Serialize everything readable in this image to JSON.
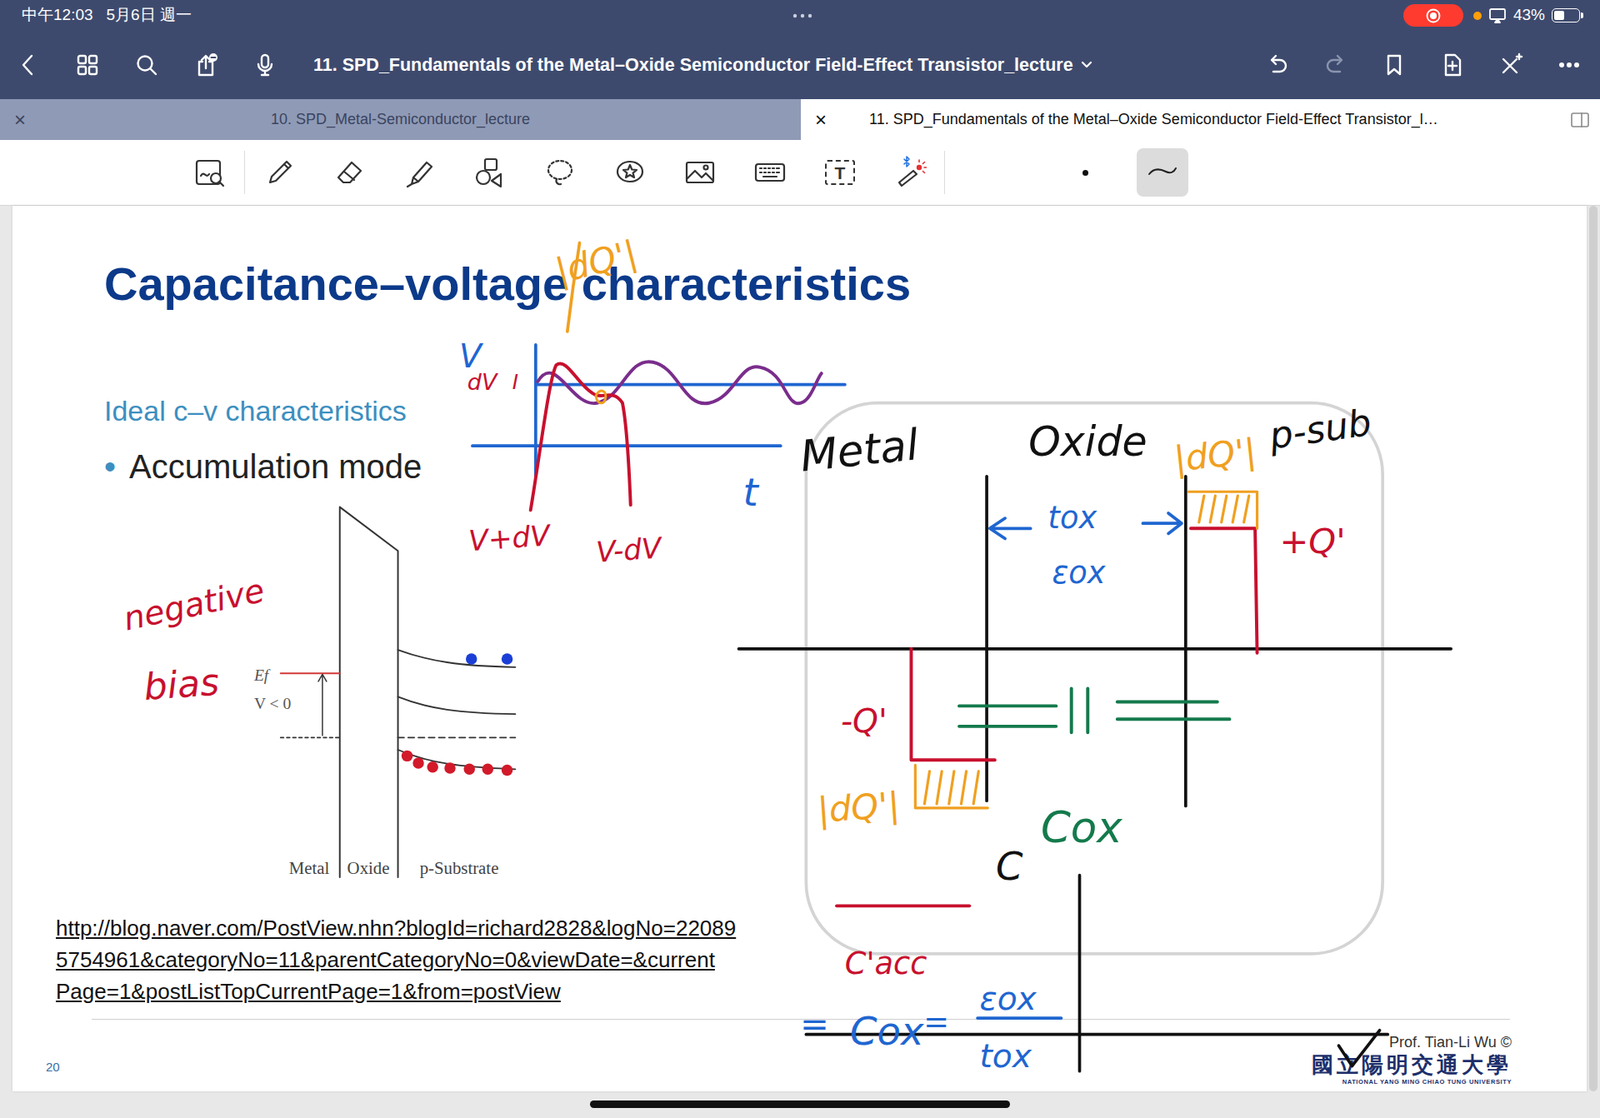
{
  "status_bar": {
    "time": "中午12:03",
    "date": "5月6日 週一",
    "recording": true,
    "battery": "43%",
    "battery_level": 0.43
  },
  "toolbar": {
    "left": [
      {
        "kind": "back"
      },
      {
        "kind": "grid"
      },
      {
        "kind": "search"
      },
      {
        "kind": "share"
      },
      {
        "kind": "mic"
      }
    ],
    "title": "11. SPD_Fundamentals of the Metal–Oxide Semiconductor Field-Effect Transistor_lecture",
    "right": [
      {
        "kind": "undo",
        "disabled": false
      },
      {
        "kind": "redo",
        "disabled": true
      },
      {
        "kind": "bookmark",
        "disabled": false
      },
      {
        "kind": "add-page",
        "disabled": false
      },
      {
        "kind": "close-tools",
        "disabled": false
      },
      {
        "kind": "more",
        "disabled": false
      }
    ]
  },
  "tabs": [
    {
      "label": "10. SPD_Metal-Semiconductor_lecture",
      "close": "×",
      "selected": false
    },
    {
      "label": "11. SPD_Fundamentals of the Metal–Oxide Semiconductor Field-Effect Transistor_l…",
      "close": "×",
      "selected": true
    }
  ],
  "tools": [
    {
      "kind": "zoom-write",
      "selected": false
    },
    {
      "kind": "pen",
      "selected": false
    },
    {
      "kind": "eraser",
      "selected": false
    },
    {
      "kind": "highlighter",
      "selected": false
    },
    {
      "kind": "shapes",
      "selected": false
    },
    {
      "kind": "lasso",
      "selected": false
    },
    {
      "kind": "sticker",
      "selected": false
    },
    {
      "kind": "image",
      "selected": false
    },
    {
      "kind": "keyboard",
      "selected": false
    },
    {
      "kind": "text",
      "label": "T",
      "selected": false
    },
    {
      "kind": "laser",
      "selected": false
    }
  ],
  "pen_options": [
    {
      "kind": "dot",
      "selected": false
    },
    {
      "kind": "stroke",
      "selected": true
    }
  ],
  "slide": {
    "title": "Capacitance–voltage characteristics",
    "subtitle": "Ideal c–v characteristics",
    "bullet": "•",
    "bullet_text": "Accumulation mode",
    "url_lines": [
      "http://blog.naver.com/PostView.nhn?blogId=richard2828&logNo=22089",
      "5754961&categoryNo=11&parentCategoryNo=0&viewDate=&current",
      "Page=1&postListTopCurrentPage=1&from=postView"
    ],
    "page_number": "20",
    "credit": "Prof. Tian-Li Wu ©",
    "logo_zh": "國立陽明交通大學",
    "logo_en": "NATIONAL YANG MING CHIAO TUNG UNIVERSITY"
  },
  "figure": {
    "ef": "Ef",
    "bias": "V < 0",
    "layers": [
      "Metal",
      "Oxide",
      "p-Substrate"
    ]
  },
  "annotations": [
    {
      "text": "|dQ'|",
      "color": "#f0a020"
    },
    {
      "text": "V",
      "color": "#1f66d1"
    },
    {
      "text": "dV",
      "color": "#c8102e"
    },
    {
      "text": "I",
      "color": "#c8102e"
    },
    {
      "text": "t",
      "color": "#1f66d1"
    },
    {
      "text": "V+dV",
      "color": "#c8102e"
    },
    {
      "text": "V-dV",
      "color": "#c8102e"
    },
    {
      "text": "negative",
      "color": "#c8102e"
    },
    {
      "text": "bias",
      "color": "#c8102e"
    },
    {
      "text": "Metal",
      "color": "#111111"
    },
    {
      "text": "Oxide",
      "color": "#111111"
    },
    {
      "text": "|dQ'|",
      "color": "#f0a020"
    },
    {
      "text": "p-sub",
      "color": "#111111"
    },
    {
      "text": "tox",
      "color": "#1f66d1"
    },
    {
      "text": "εox",
      "color": "#1f66d1"
    },
    {
      "text": "+Q'",
      "color": "#c8102e"
    },
    {
      "text": "-Q'",
      "color": "#c8102e"
    },
    {
      "text": "|dQ'|",
      "color": "#f0a020"
    },
    {
      "text": "Cox",
      "color": "#147a4c"
    },
    {
      "text": "C",
      "color": "#111111"
    },
    {
      "text": "C'acc",
      "color": "#c8102e"
    },
    {
      "text": "=",
      "color": "#1f66d1"
    },
    {
      "text": "Cox",
      "color": "#1f66d1"
    },
    {
      "text": "=",
      "color": "#1f66d1"
    },
    {
      "text": "εox",
      "color": "#1f66d1"
    },
    {
      "text": "tox",
      "color": "#1f66d1"
    }
  ]
}
